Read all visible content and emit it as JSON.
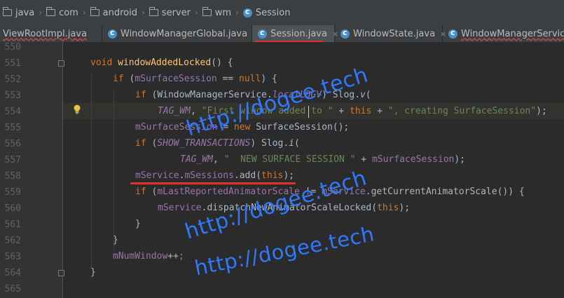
{
  "breadcrumb": [
    {
      "label": "java",
      "icon": "folder-icon"
    },
    {
      "label": "com",
      "icon": "folder-icon"
    },
    {
      "label": "android",
      "icon": "folder-icon"
    },
    {
      "label": "server",
      "icon": "folder-icon"
    },
    {
      "label": "wm",
      "icon": "folder-icon"
    },
    {
      "label": "Session",
      "icon": "class-icon"
    }
  ],
  "tabs": [
    {
      "label": "ViewRootImpl.java",
      "active": false,
      "error": true
    },
    {
      "label": "WindowManagerGlobal.java",
      "active": false,
      "error": false
    },
    {
      "label": "Session.java",
      "active": true,
      "error": false
    },
    {
      "label": "WindowState.java",
      "active": false,
      "error": false
    },
    {
      "label": "WindowManagerService.java",
      "active": false,
      "error": true
    }
  ],
  "line_numbers": [
    "550",
    "551",
    "552",
    "553",
    "554",
    "555",
    "556",
    "557",
    "558",
    "559",
    "560",
    "561",
    "562",
    "563",
    "564",
    "565"
  ],
  "code": {
    "l551": {
      "kw_void": "void",
      "method": "windowAddedLocked",
      "rest": "() {"
    },
    "l552": {
      "kw_if": "if",
      "p1": " (",
      "field": "mSurfaceSession",
      "op": " == ",
      "kw_null": "null",
      "p2": ") {"
    },
    "l553": {
      "kw_if": "if",
      "p1": " (",
      "cls": "WindowManagerService",
      "dot": ".",
      "field": "localLOGV",
      "p2": ") ",
      "cls2": "Slog",
      "dot2": ".",
      "fn": "v",
      "p3": "("
    },
    "l554": {
      "field": "TAG_WM",
      "comma": ", ",
      "str": "\"First window added to \"",
      "plus1": " + ",
      "kw_this": "this",
      "plus2": " + ",
      "str2": "\", creating SurfaceSession\"",
      "end": ");"
    },
    "l555": {
      "field": "mSurfaceSession",
      "eq": " = ",
      "kw_new": "new",
      "cls": " SurfaceSession",
      "end": "();"
    },
    "l556": {
      "kw_if": "if",
      "p1": " (",
      "field": "SHOW_TRANSACTIONS",
      "p2": ") ",
      "cls2": "Slog",
      "dot2": ".",
      "fn": "i",
      "p3": "("
    },
    "l557": {
      "field": "TAG_WM",
      "comma": ", ",
      "str": "\"  NEW SURFACE SESSION \"",
      "plus": " + ",
      "field2": "mSurfaceSession",
      "end": ");"
    },
    "l558": {
      "field": "mService",
      "dot": ".",
      "field2": "mSessions",
      "call": ".add(",
      "kw_this": "this",
      "end": ");"
    },
    "l559": {
      "kw_if": "if",
      "p1": " (",
      "field": "mLastReportedAnimatorScale",
      "op": " != ",
      "field2": "mService",
      "rest": ".getCurrentAnimatorScale()) {"
    },
    "l560": {
      "field": "mService",
      "rest": ".dispatchNewAnimatorScaleLocked(",
      "kw_this": "this",
      "end": ");"
    },
    "l561": {
      "brace": "}"
    },
    "l562": {
      "brace": "}"
    },
    "l563": {
      "field": "mNumWindow",
      "rest": "++",
      "semi": ";"
    },
    "l564": {
      "brace": "}"
    }
  },
  "watermarks": [
    "http://dogee.tech",
    "http://dogee.tech",
    "http://dogee.tech"
  ],
  "colors": {
    "keyword": "#cc7832",
    "field": "#9876aa",
    "string": "#6a8759",
    "method": "#ffc66d",
    "text": "#a9b7c6",
    "annotation_red": "#e0302e",
    "watermark": "#2f79ff"
  }
}
